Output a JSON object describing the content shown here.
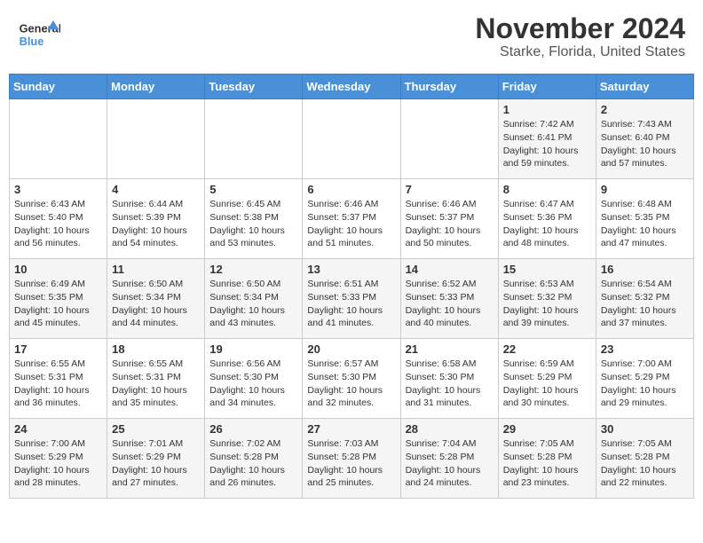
{
  "header": {
    "logo_line1": "General",
    "logo_line2": "Blue",
    "title": "November 2024",
    "subtitle": "Starke, Florida, United States"
  },
  "calendar": {
    "days_of_week": [
      "Sunday",
      "Monday",
      "Tuesday",
      "Wednesday",
      "Thursday",
      "Friday",
      "Saturday"
    ],
    "weeks": [
      [
        {
          "day": "",
          "info": ""
        },
        {
          "day": "",
          "info": ""
        },
        {
          "day": "",
          "info": ""
        },
        {
          "day": "",
          "info": ""
        },
        {
          "day": "",
          "info": ""
        },
        {
          "day": "1",
          "info": "Sunrise: 7:42 AM\nSunset: 6:41 PM\nDaylight: 10 hours and 59 minutes."
        },
        {
          "day": "2",
          "info": "Sunrise: 7:43 AM\nSunset: 6:40 PM\nDaylight: 10 hours and 57 minutes."
        }
      ],
      [
        {
          "day": "3",
          "info": "Sunrise: 6:43 AM\nSunset: 5:40 PM\nDaylight: 10 hours and 56 minutes."
        },
        {
          "day": "4",
          "info": "Sunrise: 6:44 AM\nSunset: 5:39 PM\nDaylight: 10 hours and 54 minutes."
        },
        {
          "day": "5",
          "info": "Sunrise: 6:45 AM\nSunset: 5:38 PM\nDaylight: 10 hours and 53 minutes."
        },
        {
          "day": "6",
          "info": "Sunrise: 6:46 AM\nSunset: 5:37 PM\nDaylight: 10 hours and 51 minutes."
        },
        {
          "day": "7",
          "info": "Sunrise: 6:46 AM\nSunset: 5:37 PM\nDaylight: 10 hours and 50 minutes."
        },
        {
          "day": "8",
          "info": "Sunrise: 6:47 AM\nSunset: 5:36 PM\nDaylight: 10 hours and 48 minutes."
        },
        {
          "day": "9",
          "info": "Sunrise: 6:48 AM\nSunset: 5:35 PM\nDaylight: 10 hours and 47 minutes."
        }
      ],
      [
        {
          "day": "10",
          "info": "Sunrise: 6:49 AM\nSunset: 5:35 PM\nDaylight: 10 hours and 45 minutes."
        },
        {
          "day": "11",
          "info": "Sunrise: 6:50 AM\nSunset: 5:34 PM\nDaylight: 10 hours and 44 minutes."
        },
        {
          "day": "12",
          "info": "Sunrise: 6:50 AM\nSunset: 5:34 PM\nDaylight: 10 hours and 43 minutes."
        },
        {
          "day": "13",
          "info": "Sunrise: 6:51 AM\nSunset: 5:33 PM\nDaylight: 10 hours and 41 minutes."
        },
        {
          "day": "14",
          "info": "Sunrise: 6:52 AM\nSunset: 5:33 PM\nDaylight: 10 hours and 40 minutes."
        },
        {
          "day": "15",
          "info": "Sunrise: 6:53 AM\nSunset: 5:32 PM\nDaylight: 10 hours and 39 minutes."
        },
        {
          "day": "16",
          "info": "Sunrise: 6:54 AM\nSunset: 5:32 PM\nDaylight: 10 hours and 37 minutes."
        }
      ],
      [
        {
          "day": "17",
          "info": "Sunrise: 6:55 AM\nSunset: 5:31 PM\nDaylight: 10 hours and 36 minutes."
        },
        {
          "day": "18",
          "info": "Sunrise: 6:55 AM\nSunset: 5:31 PM\nDaylight: 10 hours and 35 minutes."
        },
        {
          "day": "19",
          "info": "Sunrise: 6:56 AM\nSunset: 5:30 PM\nDaylight: 10 hours and 34 minutes."
        },
        {
          "day": "20",
          "info": "Sunrise: 6:57 AM\nSunset: 5:30 PM\nDaylight: 10 hours and 32 minutes."
        },
        {
          "day": "21",
          "info": "Sunrise: 6:58 AM\nSunset: 5:30 PM\nDaylight: 10 hours and 31 minutes."
        },
        {
          "day": "22",
          "info": "Sunrise: 6:59 AM\nSunset: 5:29 PM\nDaylight: 10 hours and 30 minutes."
        },
        {
          "day": "23",
          "info": "Sunrise: 7:00 AM\nSunset: 5:29 PM\nDaylight: 10 hours and 29 minutes."
        }
      ],
      [
        {
          "day": "24",
          "info": "Sunrise: 7:00 AM\nSunset: 5:29 PM\nDaylight: 10 hours and 28 minutes."
        },
        {
          "day": "25",
          "info": "Sunrise: 7:01 AM\nSunset: 5:29 PM\nDaylight: 10 hours and 27 minutes."
        },
        {
          "day": "26",
          "info": "Sunrise: 7:02 AM\nSunset: 5:28 PM\nDaylight: 10 hours and 26 minutes."
        },
        {
          "day": "27",
          "info": "Sunrise: 7:03 AM\nSunset: 5:28 PM\nDaylight: 10 hours and 25 minutes."
        },
        {
          "day": "28",
          "info": "Sunrise: 7:04 AM\nSunset: 5:28 PM\nDaylight: 10 hours and 24 minutes."
        },
        {
          "day": "29",
          "info": "Sunrise: 7:05 AM\nSunset: 5:28 PM\nDaylight: 10 hours and 23 minutes."
        },
        {
          "day": "30",
          "info": "Sunrise: 7:05 AM\nSunset: 5:28 PM\nDaylight: 10 hours and 22 minutes."
        }
      ]
    ]
  }
}
